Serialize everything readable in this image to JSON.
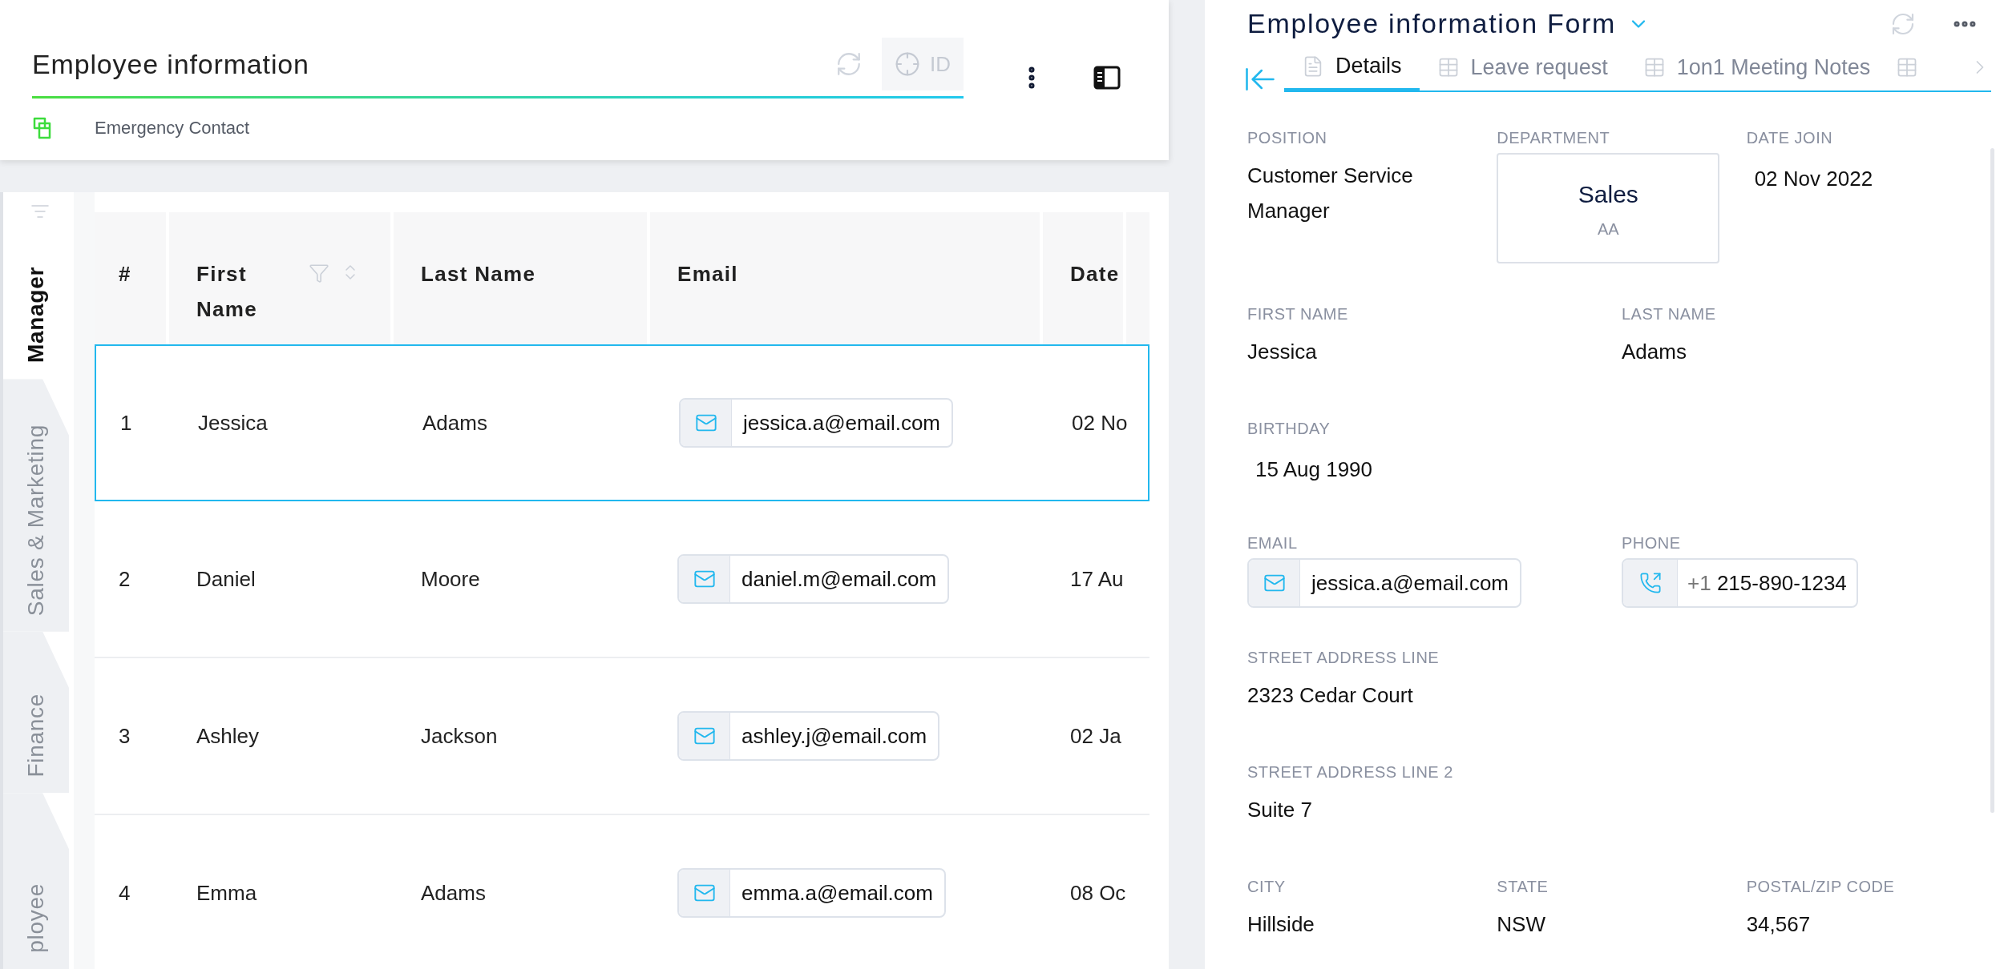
{
  "header": {
    "title": "Employee information",
    "id_button": "ID",
    "link": "Emergency Contact"
  },
  "side_tabs": [
    {
      "label": "Manager",
      "selected": true
    },
    {
      "label": "Sales & Marketing",
      "selected": false
    },
    {
      "label": "Finance",
      "selected": false
    },
    {
      "label": "ployee",
      "selected": false
    }
  ],
  "table": {
    "columns": [
      {
        "label": "#",
        "kind": "plain"
      },
      {
        "label": "First Name",
        "kind": "filterable"
      },
      {
        "label": "Last Name",
        "kind": "plain"
      },
      {
        "label": "Email",
        "kind": "plain"
      },
      {
        "label": "Date",
        "kind": "plain"
      }
    ],
    "rows": [
      {
        "number": "1",
        "first": "Jessica",
        "last": "Adams",
        "email": "jessica.a@email.com",
        "date": "02 No",
        "selected": true
      },
      {
        "number": "2",
        "first": "Daniel",
        "last": "Moore",
        "email": "daniel.m@email.com",
        "date": "17 Au",
        "selected": false
      },
      {
        "number": "3",
        "first": "Ashley",
        "last": "Jackson",
        "email": "ashley.j@email.com",
        "date": "02 Ja",
        "selected": false
      },
      {
        "number": "4",
        "first": "Emma",
        "last": "Adams",
        "email": "emma.a@email.com",
        "date": "08 Oc",
        "selected": false
      }
    ]
  },
  "form": {
    "title": "Employee information Form",
    "tabs": [
      {
        "label": "Details",
        "selected": true,
        "kind": "form"
      },
      {
        "label": "Leave request",
        "selected": false,
        "kind": "table"
      },
      {
        "label": "1on1 Meeting Notes",
        "selected": false,
        "kind": "table"
      }
    ],
    "rows": [
      [
        {
          "label": "POSITION",
          "kind": "text",
          "value": "Customer Service Manager"
        },
        {
          "label": "DEPARTMENT",
          "kind": "card",
          "value": "Sales",
          "sub": "AA"
        },
        {
          "label": "DATE JOIN",
          "kind": "date",
          "value": "02 Nov 2022"
        }
      ],
      [
        {
          "label": "FIRST NAME",
          "kind": "text",
          "value": "Jessica"
        },
        {
          "label": "LAST NAME",
          "kind": "text",
          "value": "Adams"
        }
      ],
      [
        {
          "label": "BIRTHDAY",
          "kind": "date",
          "value": "15 Aug 1990"
        }
      ],
      [
        {
          "label": "EMAIL",
          "kind": "email",
          "value": "jessica.a@email.com"
        },
        {
          "label": "PHONE",
          "kind": "phone",
          "prefix": "+1",
          "value": "215-890-1234"
        }
      ],
      [
        {
          "label": "STREET ADDRESS LINE",
          "kind": "text",
          "value": "2323 Cedar Court"
        }
      ],
      [
        {
          "label": "STREET ADDRESS LINE 2",
          "kind": "text",
          "value": "Suite 7"
        }
      ],
      [
        {
          "label": "CITY",
          "kind": "text",
          "value": "Hillside"
        },
        {
          "label": "STATE",
          "kind": "text",
          "value": "NSW"
        },
        {
          "label": "POSTAL/ZIP CODE",
          "kind": "text",
          "value": "34,567"
        }
      ]
    ]
  }
}
